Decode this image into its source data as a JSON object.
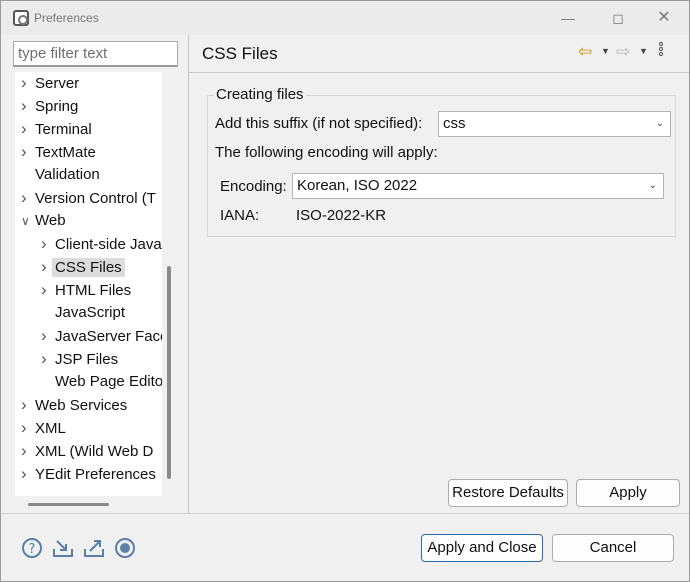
{
  "window": {
    "title": "Preferences"
  },
  "filter": {
    "placeholder": "type filter text"
  },
  "tree": {
    "items": [
      {
        "label": "Server",
        "expandable": true,
        "level": 0
      },
      {
        "label": "Spring",
        "expandable": true,
        "level": 0
      },
      {
        "label": "Terminal",
        "expandable": true,
        "level": 0
      },
      {
        "label": "TextMate",
        "expandable": true,
        "level": 0
      },
      {
        "label": "Validation",
        "expandable": false,
        "level": 0
      },
      {
        "label": "Version Control (T",
        "expandable": true,
        "level": 0
      },
      {
        "label": "Web",
        "expandable": true,
        "expanded": true,
        "level": 0
      },
      {
        "label": "Client-side Java",
        "expandable": true,
        "level": 1
      },
      {
        "label": "CSS Files",
        "expandable": true,
        "level": 1,
        "selected": true
      },
      {
        "label": "HTML Files",
        "expandable": true,
        "level": 1
      },
      {
        "label": "JavaScript",
        "expandable": false,
        "level": 1
      },
      {
        "label": "JavaServer Face",
        "expandable": true,
        "level": 1
      },
      {
        "label": "JSP Files",
        "expandable": true,
        "level": 1
      },
      {
        "label": "Web Page Edito",
        "expandable": false,
        "level": 1
      },
      {
        "label": "Web Services",
        "expandable": true,
        "level": 0
      },
      {
        "label": "XML",
        "expandable": true,
        "level": 0
      },
      {
        "label": "XML (Wild Web D",
        "expandable": true,
        "level": 0
      },
      {
        "label": "YEdit Preferences",
        "expandable": true,
        "level": 0
      }
    ]
  },
  "page": {
    "title": "CSS Files",
    "group_title": "Creating files",
    "suffix_label": "Add this suffix (if not specified):",
    "suffix_value": "css",
    "encoding_intro": "The following encoding will apply:",
    "encoding_label": "Encoding:",
    "encoding_value": "Korean, ISO 2022",
    "iana_label": "IANA:",
    "iana_value": "ISO-2022-KR"
  },
  "buttons": {
    "restore_defaults": "Restore Defaults",
    "apply": "Apply",
    "apply_and_close": "Apply and Close",
    "cancel": "Cancel"
  },
  "colors": {
    "accent": "#2b6ab3",
    "back_arrow": "#d08a00"
  }
}
